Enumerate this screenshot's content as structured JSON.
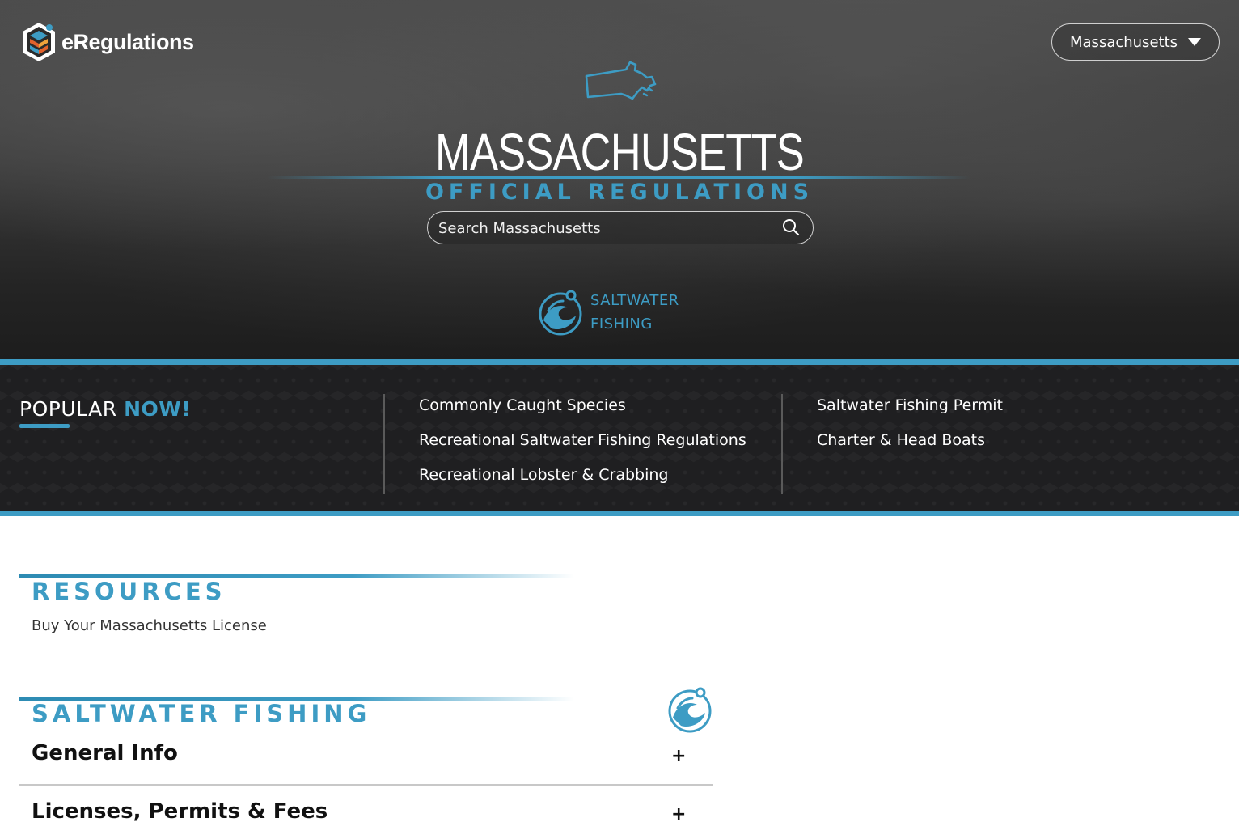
{
  "header": {
    "logo_text": "eRegulations",
    "state_selector": "Massachusetts"
  },
  "hero": {
    "title": "MASSACHUSETTS",
    "subtitle": "OFFICIAL REGULATIONS",
    "search_placeholder": "Search Massachusetts",
    "category_line1": "SALTWATER",
    "category_line2": "FISHING"
  },
  "popular": {
    "heading_main": "POPULAR",
    "heading_accent": "NOW!",
    "col1": [
      "Commonly Caught Species",
      "Recreational Saltwater Fishing Regulations",
      "Recreational Lobster & Crabbing"
    ],
    "col2": [
      "Saltwater Fishing Permit",
      "Charter & Head Boats"
    ]
  },
  "resources": {
    "heading": "RESOURCES",
    "link": "Buy Your Massachusetts License"
  },
  "saltwater": {
    "heading": "SALTWATER FISHING",
    "items": [
      {
        "title": "General Info",
        "toggle": "+"
      },
      {
        "title": "Licenses, Permits & Fees",
        "toggle": "+"
      }
    ]
  },
  "colors": {
    "accent": "#3d9cc4",
    "dark": "#1f1f21",
    "text": "#111111"
  }
}
